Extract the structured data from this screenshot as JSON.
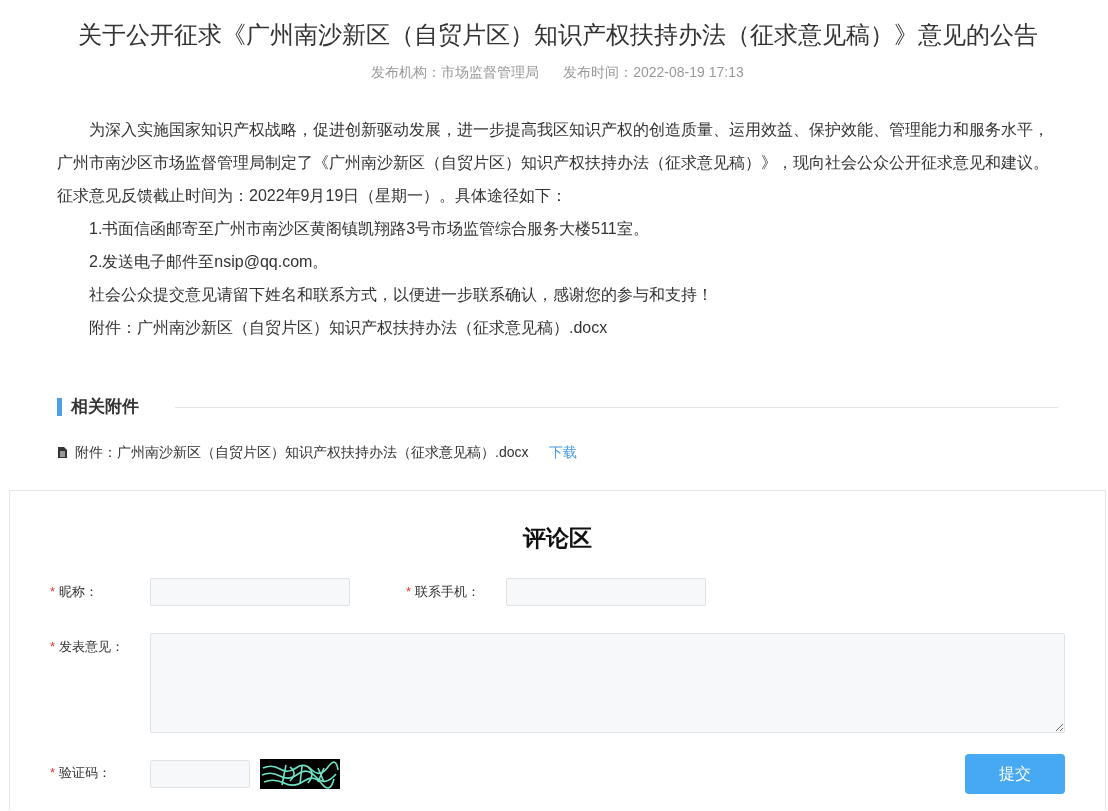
{
  "article": {
    "title": "关于公开征求《广州南沙新区（自贸片区）知识产权扶持办法（征求意见稿）》意见的公告",
    "meta": [
      "发布机构：市场监督管理局",
      "发布时间：2022-08-19 17:13"
    ],
    "paragraphs": [
      "为深入实施国家知识产权战略，促进创新驱动发展，进一步提高我区知识产权的创造质量、运用效益、保护效能、管理能力和服务水平，广州市南沙区市场监督管理局制定了《广州南沙新区（自贸片区）知识产权扶持办法（征求意见稿）》，现向社会公众公开征求意见和建议。征求意见反馈截止时间为：2022年9月19日（星期一）。具体途径如下：",
      "1.书面信函邮寄至广州市南沙区黄阁镇凯翔路3号市场监管综合服务大楼511室。",
      "2.发送电子邮件至nsip@qq.com。",
      "社会公众提交意见请留下姓名和联系方式，以便进一步联系确认，感谢您的参与和支持！",
      "附件：广州南沙新区（自贸片区）知识产权扶持办法（征求意见稿）.docx"
    ]
  },
  "attachments": {
    "heading": "相关附件",
    "items": [
      {
        "name": "附件：广州南沙新区（自贸片区）知识产权扶持办法（征求意见稿）.docx",
        "action": "下载"
      }
    ]
  },
  "comments": {
    "title": "评论区",
    "rows": [
      {
        "fields": [
          {
            "kind": "input",
            "mark": "*",
            "label": "昵称："
          },
          {
            "kind": "input",
            "mark": "*",
            "label": "联系手机："
          }
        ]
      },
      {
        "fields": [
          {
            "kind": "textarea",
            "mark": "*",
            "label": "发表意见："
          }
        ]
      },
      {
        "fields": [
          {
            "kind": "captcha",
            "mark": "*",
            "label": "验证码："
          }
        ]
      }
    ],
    "submit": "提交"
  }
}
